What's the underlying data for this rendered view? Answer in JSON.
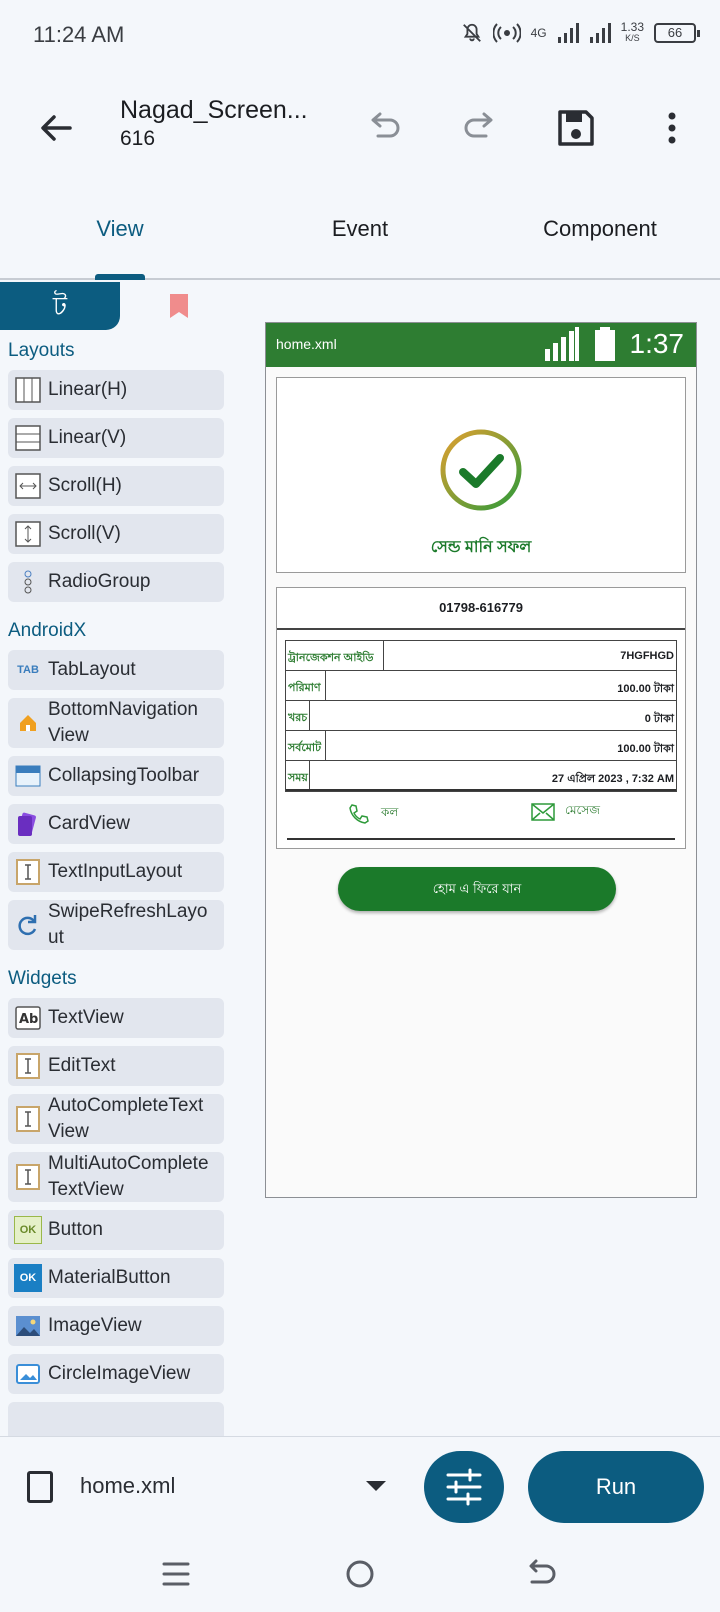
{
  "status_bar": {
    "time": "11:24 AM",
    "network": "4G",
    "speed": "1.33",
    "speed_unit": "K/S",
    "battery": "66"
  },
  "app_bar": {
    "title": "Nagad_Screen...",
    "subtitle": "616"
  },
  "tabs": [
    {
      "label": "View",
      "active": true
    },
    {
      "label": "Event",
      "active": false
    },
    {
      "label": "Component",
      "active": false
    }
  ],
  "palette": {
    "tab_glyph": "ট",
    "sections": [
      {
        "title": "Layouts",
        "items": [
          {
            "label": "Linear(H)",
            "icon": "linear-h-icon"
          },
          {
            "label": "Linear(V)",
            "icon": "linear-v-icon"
          },
          {
            "label": "Scroll(H)",
            "icon": "scroll-h-icon"
          },
          {
            "label": "Scroll(V)",
            "icon": "scroll-v-icon"
          },
          {
            "label": "RadioGroup",
            "icon": "radio-group-icon"
          }
        ]
      },
      {
        "title": "AndroidX",
        "items": [
          {
            "label": "TabLayout",
            "icon": "tab-layout-icon"
          },
          {
            "label": "BottomNavigation View",
            "icon": "bottom-navigation-icon"
          },
          {
            "label": "CollapsingToolbar",
            "icon": "collapsing-toolbar-icon"
          },
          {
            "label": "CardView",
            "icon": "card-view-icon"
          },
          {
            "label": "TextInputLayout",
            "icon": "text-input-icon"
          },
          {
            "label": "SwipeRefreshLayo ut",
            "icon": "swipe-refresh-icon"
          }
        ]
      },
      {
        "title": "Widgets",
        "items": [
          {
            "label": "TextView",
            "icon": "text-view-icon"
          },
          {
            "label": "EditText",
            "icon": "edit-text-icon"
          },
          {
            "label": "AutoCompleteText View",
            "icon": "autocomplete-icon"
          },
          {
            "label": "MultiAutoComplete TextView",
            "icon": "multi-autocomplete-icon"
          },
          {
            "label": "Button",
            "icon": "button-icon"
          },
          {
            "label": "MaterialButton",
            "icon": "material-button-icon"
          },
          {
            "label": "ImageView",
            "icon": "image-view-icon"
          },
          {
            "label": "CircleImageView",
            "icon": "circle-image-icon"
          }
        ]
      }
    ]
  },
  "preview": {
    "file": "home.xml",
    "time": "1:37",
    "success_text": "সেন্ড মানি সফল",
    "phone": "01798-616779",
    "rows": [
      {
        "key": "ট্রানজেকশন আইডি",
        "value": "7HGFHGD"
      },
      {
        "key": "পরিমাণ",
        "value": "100.00 টাকা"
      },
      {
        "key": "খরচ",
        "value": "0 টাকা"
      },
      {
        "key": "সর্বমোট",
        "value": "100.00 টাকা"
      },
      {
        "key": "সময়",
        "value": "27 এপ্রিল 2023 , 7:32 AM"
      }
    ],
    "call_label": "কল",
    "message_label": "মেসেজ",
    "home_button": "হোম এ ফিরে যান"
  },
  "bottom_bar": {
    "file_name": "home.xml",
    "run_label": "Run"
  },
  "colors": {
    "accent": "#0c5c80",
    "preview_green": "#2e7d32"
  }
}
